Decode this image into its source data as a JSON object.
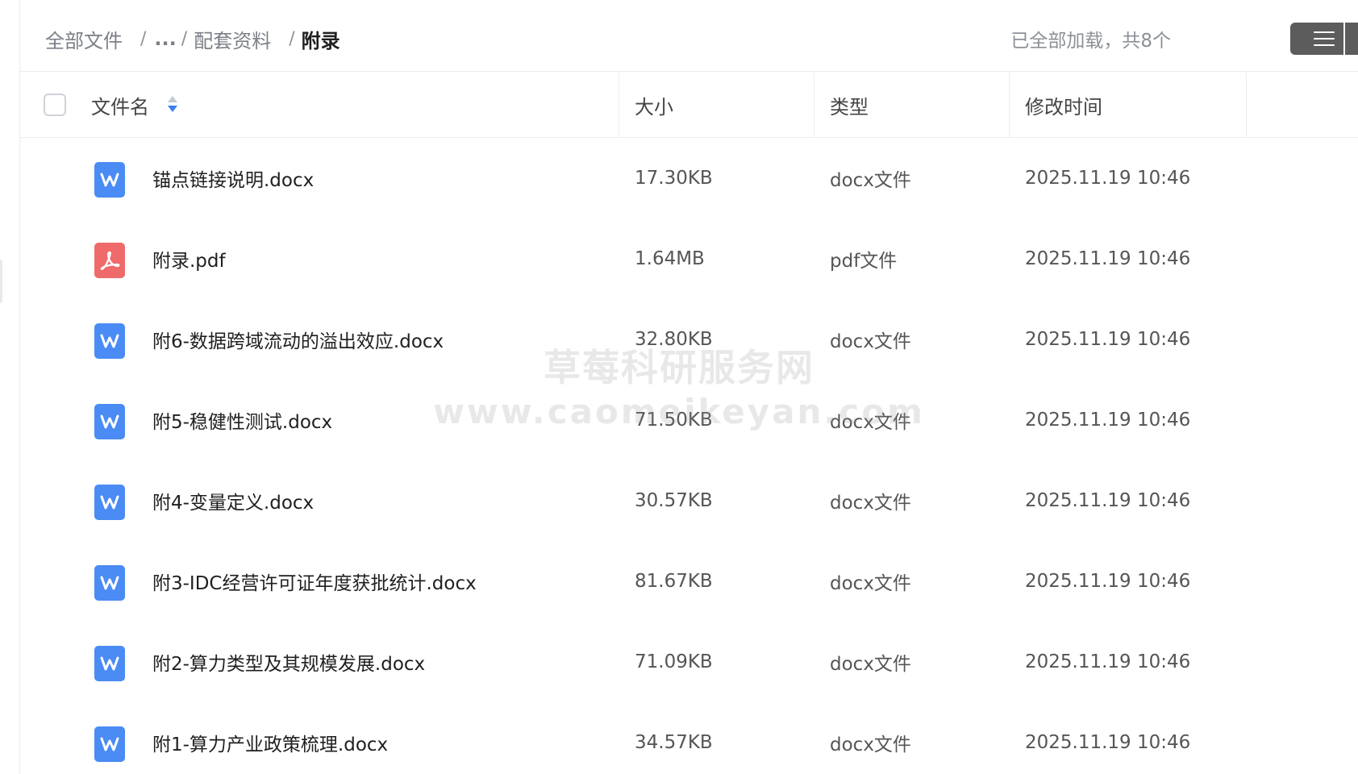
{
  "breadcrumb": {
    "root": "全部文件",
    "separator": "/",
    "ellipsis": "...",
    "parent": "配套资料",
    "current": "附录"
  },
  "load_status": "已全部加载，共8个",
  "view_toggle": {
    "icon": "list-menu-icon",
    "background": "#5c5c5c"
  },
  "table": {
    "columns": {
      "name": "文件名",
      "size": "大小",
      "type": "类型",
      "modified": "修改时间"
    },
    "sort_icon": "sort-caret-icon",
    "rows": [
      {
        "icon": "word-icon",
        "kind": "docx",
        "name": "锚点链接说明.docx",
        "size": "17.30KB",
        "type": "docx文件",
        "modified": "2025.11.19 10:46"
      },
      {
        "icon": "pdf-icon",
        "kind": "pdf",
        "name": "附录.pdf",
        "size": "1.64MB",
        "type": "pdf文件",
        "modified": "2025.11.19 10:46"
      },
      {
        "icon": "word-icon",
        "kind": "docx",
        "name": "附6-数据跨域流动的溢出效应.docx",
        "size": "32.80KB",
        "type": "docx文件",
        "modified": "2025.11.19 10:46"
      },
      {
        "icon": "word-icon",
        "kind": "docx",
        "name": "附5-稳健性测试.docx",
        "size": "71.50KB",
        "type": "docx文件",
        "modified": "2025.11.19 10:46"
      },
      {
        "icon": "word-icon",
        "kind": "docx",
        "name": "附4-变量定义.docx",
        "size": "30.57KB",
        "type": "docx文件",
        "modified": "2025.11.19 10:46"
      },
      {
        "icon": "word-icon",
        "kind": "docx",
        "name": "附3-IDC经营许可证年度获批统计.docx",
        "size": "81.67KB",
        "type": "docx文件",
        "modified": "2025.11.19 10:46"
      },
      {
        "icon": "word-icon",
        "kind": "docx",
        "name": "附2-算力类型及其规模发展.docx",
        "size": "71.09KB",
        "type": "docx文件",
        "modified": "2025.11.19 10:46"
      },
      {
        "icon": "word-icon",
        "kind": "docx",
        "name": "附1-算力产业政策梳理.docx",
        "size": "34.57KB",
        "type": "docx文件",
        "modified": "2025.11.19 10:46"
      }
    ]
  },
  "watermark": {
    "line1": "草莓科研服务网",
    "line2": "www.caomeikeyan.com"
  },
  "colors": {
    "word": "#4a8bf4",
    "pdf": "#ef6a6a",
    "sort_active": "#3b7ff2"
  }
}
